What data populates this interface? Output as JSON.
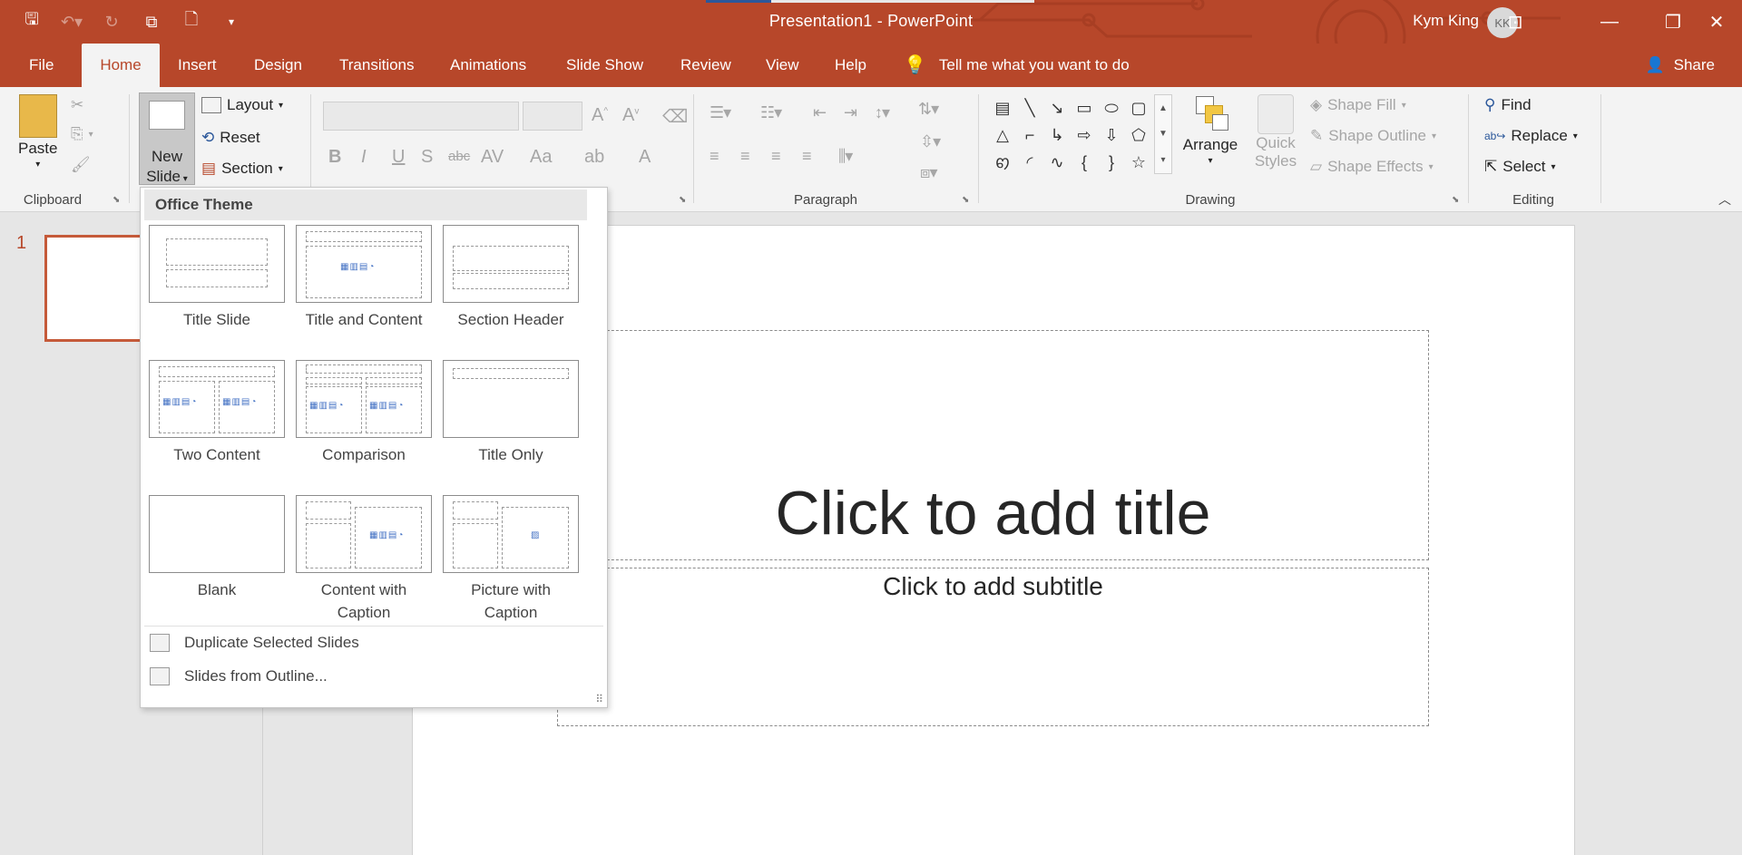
{
  "window": {
    "doc_title": "Presentation1  -  PowerPoint",
    "user_name": "Kym King",
    "user_initials": "KK",
    "accent": "#b7472a"
  },
  "qat": [
    "save-icon",
    "undo-icon",
    "redo-icon",
    "present-icon",
    "new-icon",
    "customize-icon"
  ],
  "tabs": [
    "File",
    "Home",
    "Insert",
    "Design",
    "Transitions",
    "Animations",
    "Slide Show",
    "Review",
    "View",
    "Help"
  ],
  "active_tab": "Home",
  "tellme": "Tell me what you want to do",
  "share": "Share",
  "ribbon": {
    "clipboard": {
      "paste": "Paste",
      "label": "Clipboard"
    },
    "slides": {
      "new_slide_1": "New",
      "new_slide_2": "Slide",
      "layout": "Layout",
      "reset": "Reset",
      "section": "Section"
    },
    "paragraph": {
      "label": "Paragraph"
    },
    "drawing": {
      "arrange": "Arrange",
      "quick_1": "Quick",
      "quick_2": "Styles",
      "shape_fill": "Shape Fill",
      "shape_outline": "Shape Outline",
      "shape_effects": "Shape Effects",
      "label": "Drawing"
    },
    "editing": {
      "find": "Find",
      "replace": "Replace",
      "select": "Select",
      "label": "Editing"
    }
  },
  "dropdown": {
    "header": "Office Theme",
    "layouts": [
      {
        "name": "Title Slide"
      },
      {
        "name": "Title and Content"
      },
      {
        "name": "Section Header"
      },
      {
        "name": "Two Content"
      },
      {
        "name": "Comparison"
      },
      {
        "name": "Title Only"
      },
      {
        "name": "Blank"
      },
      {
        "name_1": "Content with",
        "name_2": "Caption"
      },
      {
        "name_1": "Picture with",
        "name_2": "Caption"
      }
    ],
    "duplicate": "Duplicate Selected Slides",
    "from_outline": "Slides from Outline..."
  },
  "thumbnail": {
    "number": "1"
  },
  "slide": {
    "title_placeholder": "Click to add title",
    "subtitle_placeholder": "Click to add subtitle"
  }
}
